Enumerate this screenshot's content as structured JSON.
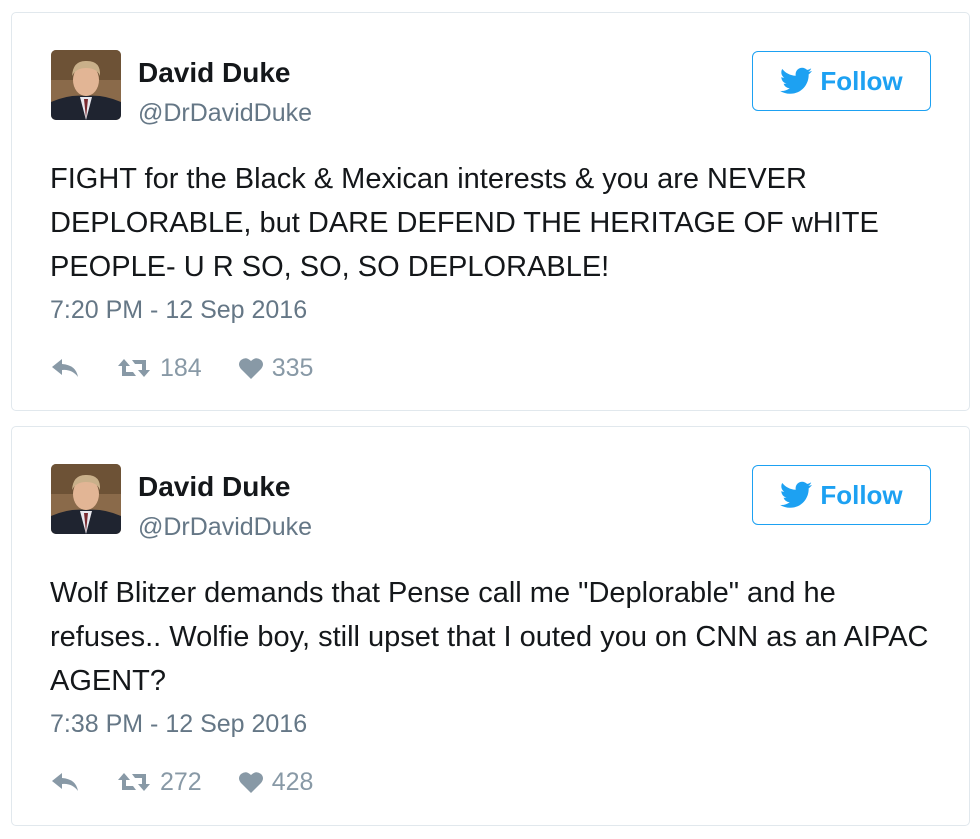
{
  "tweets": [
    {
      "name": "David Duke",
      "handle": "@DrDavidDuke",
      "follow_label": "Follow",
      "text": "FIGHT for the Black & Mexican interests & you are NEVER DEPLORABLE, but DARE DEFEND THE HERITAGE OF wHITE PEOPLE- U R SO, SO, SO DEPLORABLE!",
      "timestamp": "7:20 PM - 12 Sep 2016",
      "retweets": "184",
      "likes": "335"
    },
    {
      "name": "David Duke",
      "handle": "@DrDavidDuke",
      "follow_label": "Follow",
      "text": "Wolf Blitzer demands that Pense call me \"Deplorable\" and he refuses.. Wolfie boy, still upset that I outed you on CNN as an AIPAC AGENT?",
      "timestamp": "7:38 PM - 12 Sep 2016",
      "retweets": "272",
      "likes": "428"
    }
  ],
  "colors": {
    "accent": "#1da1f2",
    "text": "#14171a",
    "muted": "#657786",
    "icon": "#8899a6",
    "border": "#e1e8ed"
  },
  "icons": [
    "twitter-bird-icon",
    "reply-icon",
    "retweet-icon",
    "heart-icon"
  ]
}
